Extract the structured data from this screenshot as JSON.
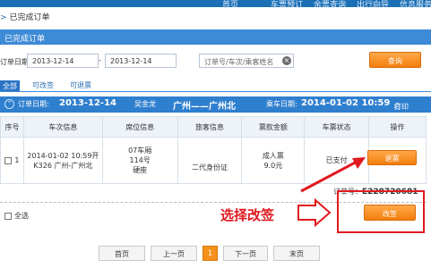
{
  "top_nav": [
    "首页",
    "车票预订",
    "余票查询",
    "出行向导",
    "信息服务"
  ],
  "breadcrumb": "已完成订单",
  "panel_title": "已完成订单",
  "filter": {
    "date_label": "订单日期",
    "date_from": "2013-12-14",
    "date_sep": "-",
    "date_to": "2013-12-14",
    "search_placeholder": "订单号/车次/乘客姓名",
    "query_button": "查询"
  },
  "tabs": [
    "全部",
    "可改签",
    "可退票"
  ],
  "order": {
    "date_label": "订单日期:",
    "date": "2013-12-14",
    "passenger_short": "吴金龙",
    "route": "广州——广州北",
    "ride_date_label": "乘车日期:",
    "ride_date": "2014-01-02 10:59",
    "print_label": "打印"
  },
  "table": {
    "headers": [
      "序号",
      "车次信息",
      "席位信息",
      "旅客信息",
      "票款金额",
      "车票状态",
      "操作"
    ],
    "rows": [
      {
        "index": "1",
        "train_time": "2014-01-02 10:59开",
        "train_route": "K326 广州-广州北",
        "seat_car": "07车厢",
        "seat_no": "114号",
        "seat_type": "硬座",
        "passenger_id": "二代身份证",
        "ticket_type": "成人票",
        "price": "9.0元",
        "status": "已支付",
        "action": "退票"
      }
    ]
  },
  "order_number_label": "订单号：",
  "order_number": "E228720681",
  "select_all": "全选",
  "change_button": "改签",
  "annotation": "选择改签",
  "pager": {
    "first": "首页",
    "prev": "上一页",
    "current": "1",
    "next": "下一页",
    "last": "末页"
  },
  "colors": {
    "primary_blue": "#3d8ad6",
    "accent_orange": "#f37e0c",
    "annotation_red": "#e0191f"
  }
}
